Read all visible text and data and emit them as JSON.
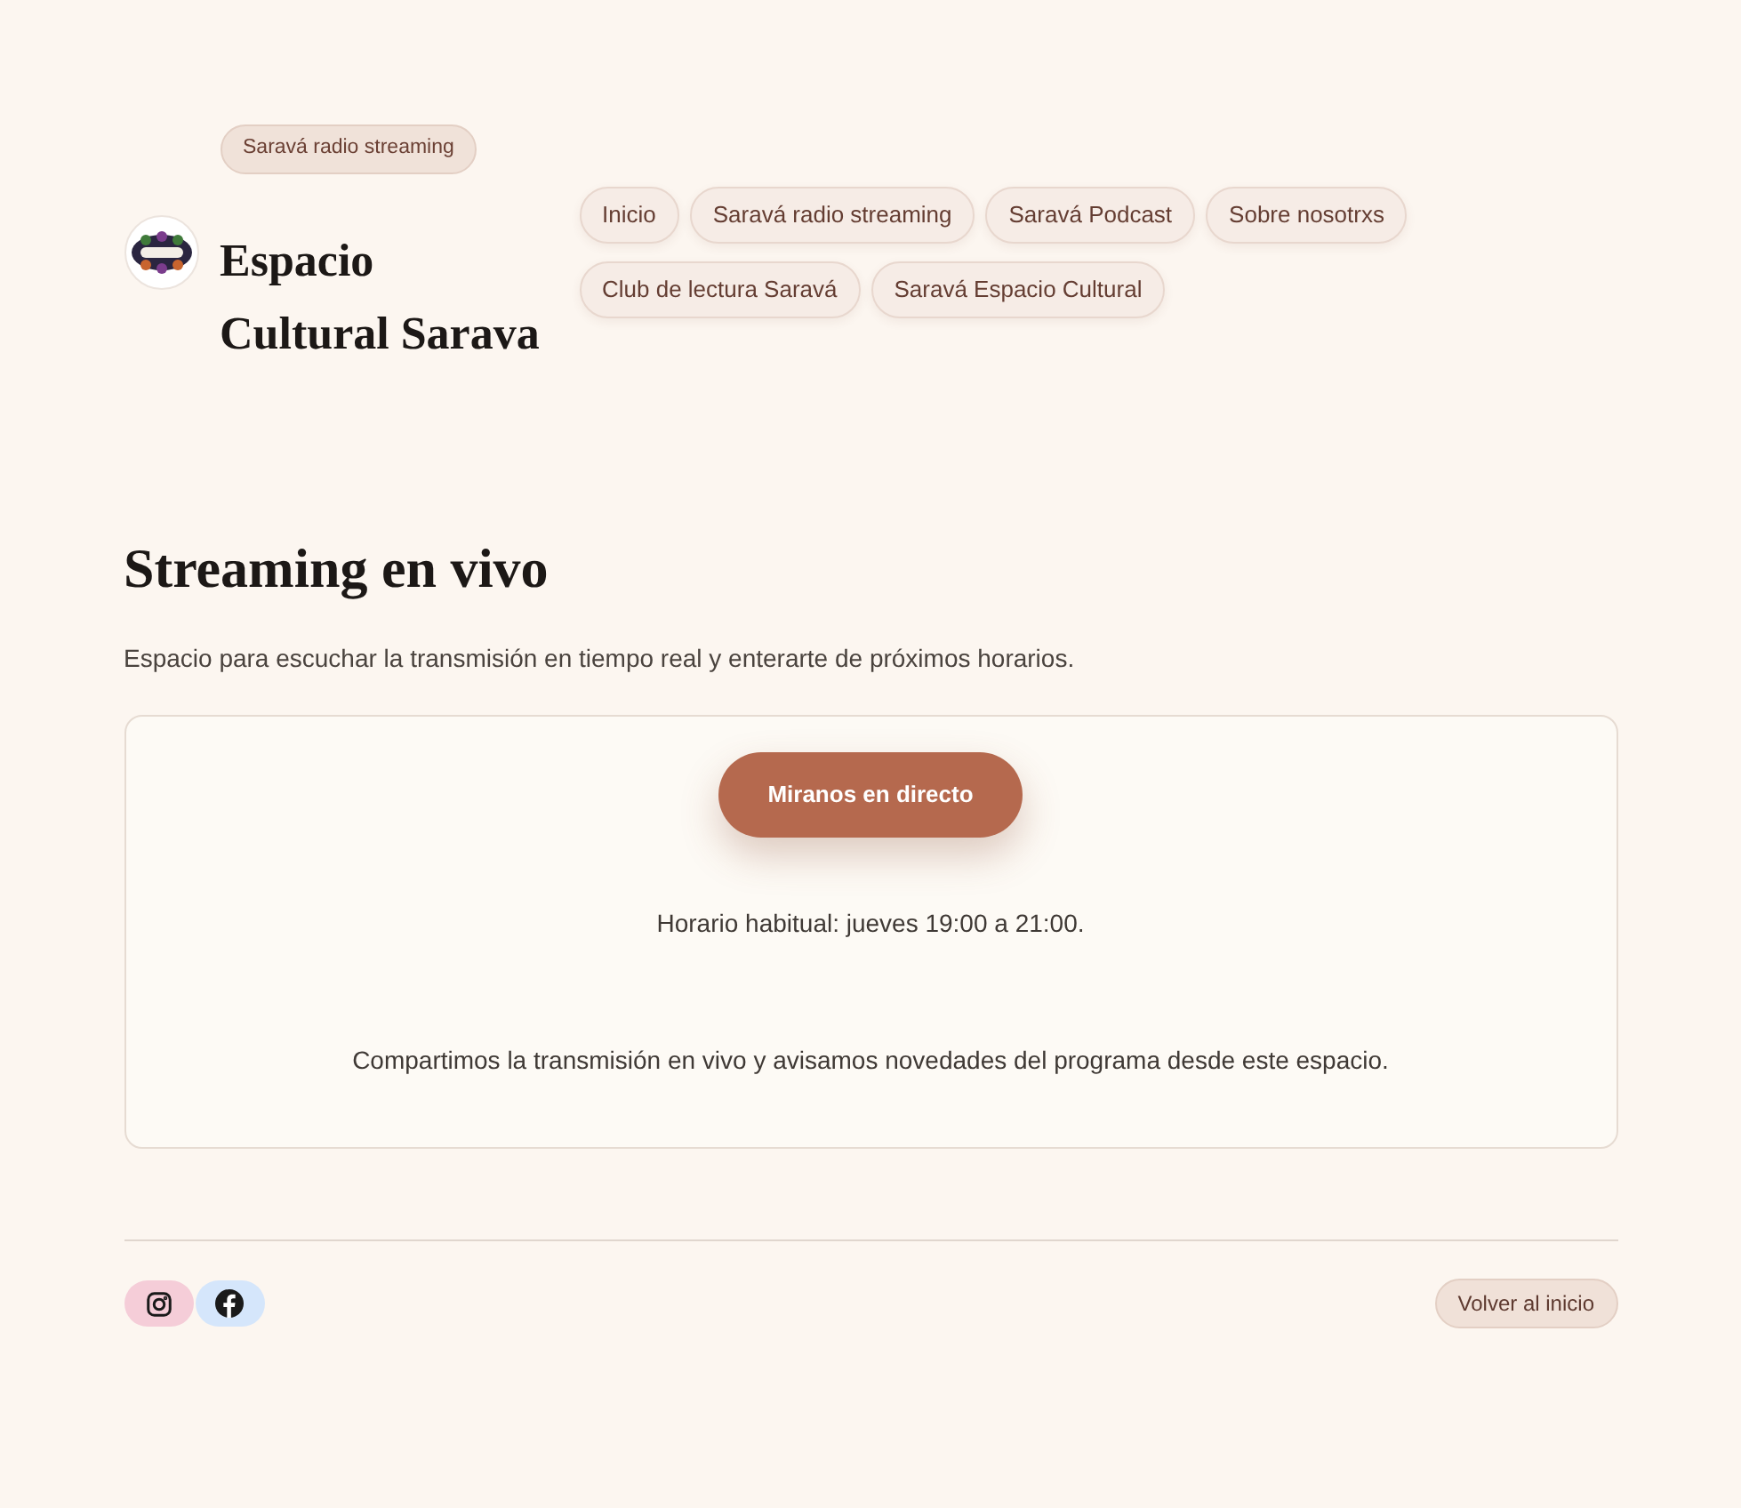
{
  "header": {
    "section_tag": "Saravá radio streaming",
    "site_title": "Espacio Cultural Sarava",
    "nav_links": [
      "Inicio",
      "Saravá radio streaming",
      "Saravá Podcast",
      "Sobre nosotrxs",
      "Club de lectura Saravá",
      "Saravá Espacio Cultural"
    ]
  },
  "main": {
    "heading": "Streaming en vivo",
    "description": "Espacio para escuchar la transmisión en tiempo real y enterarte de próximos horarios.",
    "live_card": {
      "button": "Miranos en directo",
      "schedule": "Horario habitual: jueves 19:00 a 21:00.",
      "note": "Compartimos la transmisión en vivo y avisamos novedades del programa desde este espacio."
    }
  },
  "footer": {
    "social_links": [
      {
        "kind": "instagram",
        "color": "#f5cdd8"
      },
      {
        "kind": "facebook",
        "color": "#d5e6fb"
      }
    ],
    "back_button": "Volver al inicio"
  }
}
